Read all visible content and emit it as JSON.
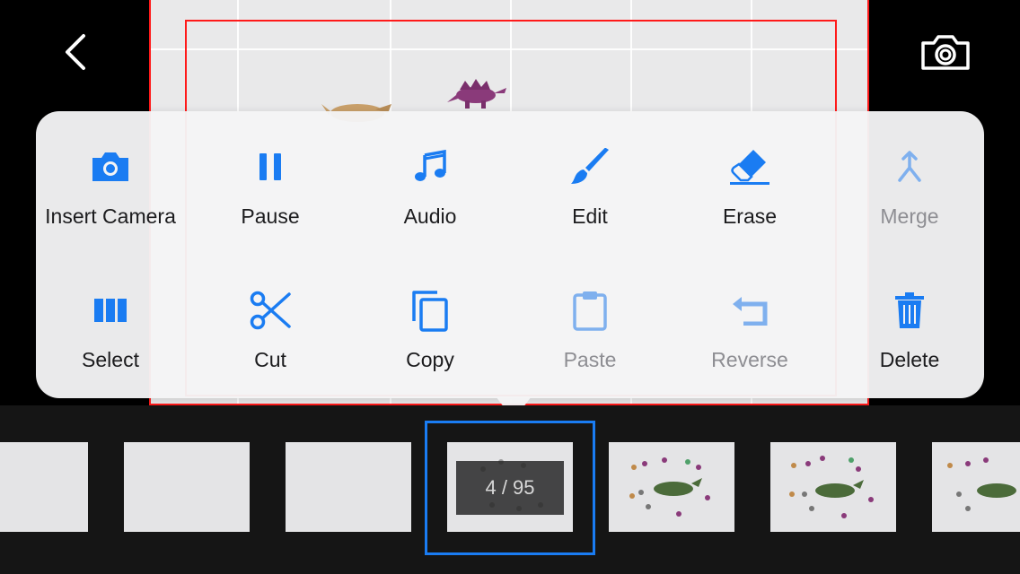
{
  "top_controls": {
    "back_icon": "chevron-left-icon",
    "camera_icon": "camera-icon"
  },
  "menu": {
    "accent": "#1a7cf2",
    "disabled_color": "#7fb0ee",
    "items": [
      {
        "label": "Insert Camera",
        "icon": "camera-icon",
        "enabled": true
      },
      {
        "label": "Pause",
        "icon": "pause-icon",
        "enabled": true
      },
      {
        "label": "Audio",
        "icon": "music-note-icon",
        "enabled": true
      },
      {
        "label": "Edit",
        "icon": "paintbrush-icon",
        "enabled": true
      },
      {
        "label": "Erase",
        "icon": "eraser-icon",
        "enabled": true
      },
      {
        "label": "Merge",
        "icon": "merge-icon",
        "enabled": false
      },
      {
        "label": "Select",
        "icon": "columns-icon",
        "enabled": true
      },
      {
        "label": "Cut",
        "icon": "scissors-icon",
        "enabled": true
      },
      {
        "label": "Copy",
        "icon": "copy-icon",
        "enabled": true
      },
      {
        "label": "Paste",
        "icon": "clipboard-icon",
        "enabled": false
      },
      {
        "label": "Reverse",
        "icon": "reverse-icon",
        "enabled": false
      },
      {
        "label": "Delete",
        "icon": "trash-icon",
        "enabled": true
      }
    ]
  },
  "filmstrip": {
    "counter": "4 / 95",
    "current_frame": 4,
    "total_frames": 95,
    "selection_color": "#1a7cf2"
  }
}
